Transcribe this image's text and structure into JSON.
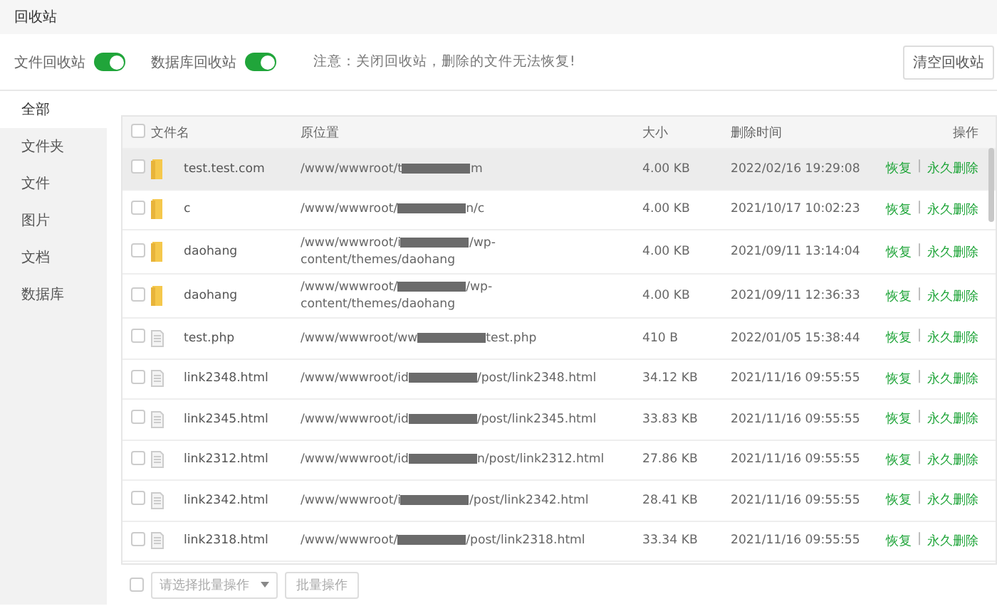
{
  "window": {
    "title": "回收站"
  },
  "settings": {
    "toggles": [
      {
        "label": "文件回收站",
        "on": true
      },
      {
        "label": "数据库回收站",
        "on": true
      }
    ],
    "notice": "注意：关闭回收站，删除的文件无法恢复!",
    "clear_button": "清空回收站"
  },
  "sidebar": {
    "items": [
      {
        "label": "全部",
        "selected": true
      },
      {
        "label": "文件夹",
        "selected": false
      },
      {
        "label": "文件",
        "selected": false
      },
      {
        "label": "图片",
        "selected": false
      },
      {
        "label": "文档",
        "selected": false
      },
      {
        "label": "数据库",
        "selected": false
      }
    ]
  },
  "table": {
    "select_all": {
      "checked": false
    },
    "columns": [
      "文件名",
      "原位置",
      "大小",
      "删除时间",
      "操作"
    ],
    "rows": [
      {
        "kind": "folder",
        "name": "test.test.com",
        "path": [
          "/www/wwwroot/t",
          "m"
        ],
        "size": "4.00 KB",
        "time": "2022/02/16 19:29:08",
        "highlighted": true,
        "checked": false,
        "actions": [
          "恢复",
          "|",
          "永久删除"
        ]
      },
      {
        "kind": "folder",
        "name": "c",
        "path": [
          "/www/wwwroot/",
          "n/c"
        ],
        "size": "4.00 KB",
        "time": "2021/10/17 10:02:23",
        "highlighted": false,
        "checked": false,
        "actions": [
          "恢复",
          "|",
          "永久删除"
        ]
      },
      {
        "kind": "folder",
        "name": "daohang",
        "path": [
          "/www/wwwroot/i",
          "/wp-content/themes/daohang"
        ],
        "size": "4.00 KB",
        "time": "2021/09/11 13:14:04",
        "highlighted": false,
        "checked": false,
        "actions": [
          "恢复",
          "|",
          "永久删除"
        ]
      },
      {
        "kind": "folder",
        "name": "daohang",
        "path": [
          "/www/wwwroot/",
          "/wp-content/themes/daohang"
        ],
        "size": "4.00 KB",
        "time": "2021/09/11 12:36:33",
        "highlighted": false,
        "checked": false,
        "actions": [
          "恢复",
          "|",
          "永久删除"
        ]
      },
      {
        "kind": "file",
        "name": "test.php",
        "path": [
          "/www/wwwroot/ww",
          "test.php"
        ],
        "size": "410 B",
        "time": "2022/01/05 15:38:44",
        "highlighted": false,
        "checked": false,
        "actions": [
          "恢复",
          "|",
          "永久删除"
        ]
      },
      {
        "kind": "file",
        "name": "link2348.html",
        "path": [
          "/www/wwwroot/id",
          "/post/link2348.html"
        ],
        "size": "34.12 KB",
        "time": "2021/11/16 09:55:55",
        "highlighted": false,
        "checked": false,
        "actions": [
          "恢复",
          "|",
          "永久删除"
        ]
      },
      {
        "kind": "file",
        "name": "link2345.html",
        "path": [
          "/www/wwwroot/id",
          "/post/link2345.html"
        ],
        "size": "33.83 KB",
        "time": "2021/11/16 09:55:55",
        "highlighted": false,
        "checked": false,
        "actions": [
          "恢复",
          "|",
          "永久删除"
        ]
      },
      {
        "kind": "file",
        "name": "link2312.html",
        "path": [
          "/www/wwwroot/id",
          "n/post/link2312.html"
        ],
        "size": "27.86 KB",
        "time": "2021/11/16 09:55:55",
        "highlighted": false,
        "checked": false,
        "actions": [
          "恢复",
          "|",
          "永久删除"
        ]
      },
      {
        "kind": "file",
        "name": "link2342.html",
        "path": [
          "/www/wwwroot/i",
          "/post/link2342.html"
        ],
        "size": "28.41 KB",
        "time": "2021/11/16 09:55:55",
        "highlighted": false,
        "checked": false,
        "actions": [
          "恢复",
          "|",
          "永久删除"
        ]
      },
      {
        "kind": "file",
        "name": "link2318.html",
        "path": [
          "/www/wwwroot/",
          "/post/link2318.html"
        ],
        "size": "33.34 KB",
        "time": "2021/11/16 09:55:55",
        "highlighted": false,
        "checked": false,
        "actions": [
          "恢复",
          "|",
          "永久删除"
        ]
      }
    ]
  },
  "footer": {
    "select_all": {
      "checked": false
    },
    "batch_select": {
      "placeholder": "请选择批量操作"
    },
    "batch_button": "批量操作"
  }
}
